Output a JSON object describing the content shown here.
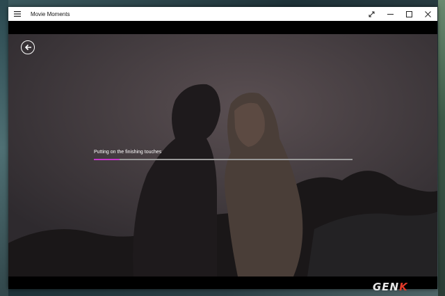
{
  "app": {
    "title": "Movie Moments",
    "menu_icon": "hamburger-menu-icon",
    "caption_icons": [
      "fullscreen-icon",
      "minimize-icon",
      "maximize-icon",
      "close-icon"
    ]
  },
  "navigation": {
    "back_icon": "arrow-left-circle-icon"
  },
  "progress": {
    "label": "Putting on the finishing touches",
    "fraction": 0.1,
    "fill_color": "#c338c9",
    "track_color": "#9a9a9a"
  },
  "watermark": {
    "text_main": "GEN",
    "text_accent": "K"
  }
}
